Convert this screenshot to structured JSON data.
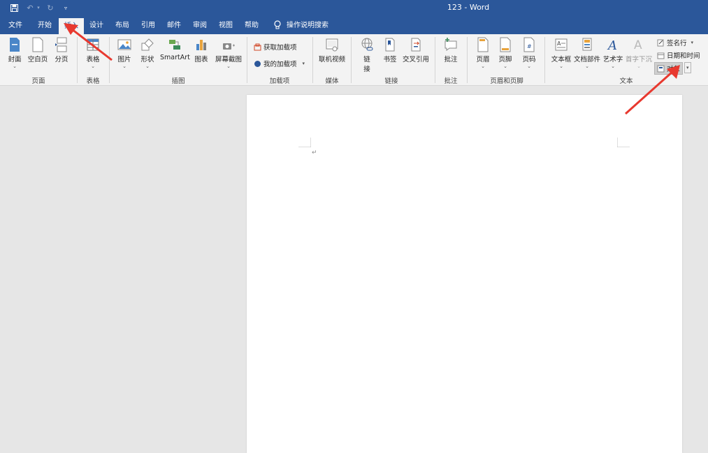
{
  "window": {
    "title": "123  -  Word"
  },
  "quick_access": {
    "save": "save-icon",
    "undo": "undo-icon",
    "redo": "redo-icon",
    "customize": "customize-icon"
  },
  "tabs": [
    "文件",
    "开始",
    "插入",
    "设计",
    "布局",
    "引用",
    "邮件",
    "审阅",
    "视图",
    "帮助"
  ],
  "active_tab": "插入",
  "tell_me": "操作说明搜索",
  "ribbon": {
    "pages": {
      "cover": "封面",
      "blank": "空白页",
      "break": "分页",
      "group": "页面"
    },
    "tables": {
      "table": "表格",
      "group": "表格"
    },
    "illustrations": {
      "picture": "图片",
      "shapes": "形状",
      "smartart": "SmartArt",
      "chart": "图表",
      "screenshot": "屏幕截图",
      "group": "插图"
    },
    "addins": {
      "get": "获取加载项",
      "mine": "我的加载项",
      "group": "加载项"
    },
    "media": {
      "video": "联机视频",
      "group": "媒体"
    },
    "links": {
      "link1": "链",
      "link2": "接",
      "bookmark": "书签",
      "crossref": "交叉引用",
      "group": "链接"
    },
    "comments": {
      "comment": "批注",
      "group": "批注"
    },
    "header_footer": {
      "header": "页眉",
      "footer": "页脚",
      "page_number": "页码",
      "group": "页眉和页脚"
    },
    "text": {
      "textbox": "文本框",
      "quickparts": "文档部件",
      "wordart": "艺术字",
      "dropcap": "首字下沉",
      "signature": "签名行",
      "datetime": "日期和时间",
      "object": "对象",
      "group": "文本"
    }
  },
  "document": {
    "paragraph_mark": "↵"
  },
  "annotation_color": "#e8392f"
}
